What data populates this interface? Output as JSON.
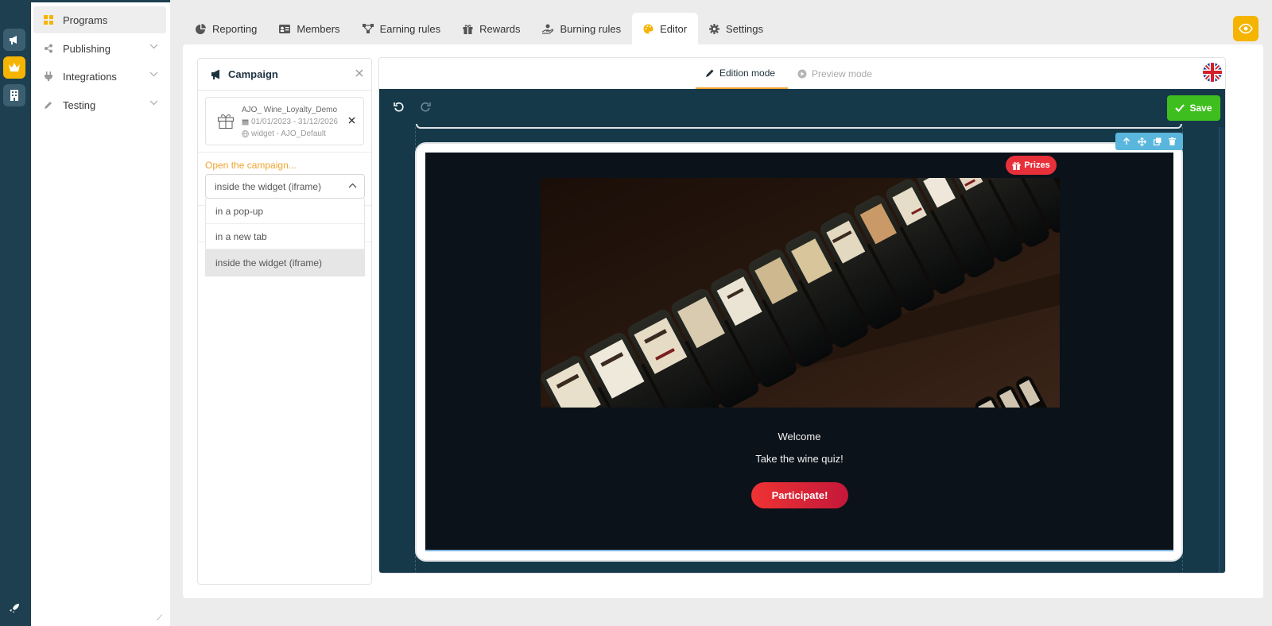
{
  "sidebar": {
    "items": [
      {
        "label": "Programs",
        "icon": "grid-icon",
        "active": true
      },
      {
        "label": "Publishing",
        "icon": "share-icon"
      },
      {
        "label": "Integrations",
        "icon": "plug-icon"
      },
      {
        "label": "Testing",
        "icon": "pencil-icon"
      }
    ]
  },
  "tabs": [
    {
      "label": "Reporting",
      "icon": "pie-chart-icon"
    },
    {
      "label": "Members",
      "icon": "id-card-icon"
    },
    {
      "label": "Earning rules",
      "icon": "flow-icon"
    },
    {
      "label": "Rewards",
      "icon": "gift-icon"
    },
    {
      "label": "Burning rules",
      "icon": "hand-coin-icon"
    },
    {
      "label": "Editor",
      "icon": "palette-icon",
      "active": true
    },
    {
      "label": "Settings",
      "icon": "gear-icon"
    }
  ],
  "panel": {
    "title": "Campaign",
    "campaign": {
      "name": "AJO_ Wine_Loyalty_Demo",
      "dates": "01/01/2023 - 31/12/2026",
      "widget": "widget - AJO_Default"
    },
    "open_label": "Open the campaign...",
    "select_value": "inside the widget (iframe)",
    "options": [
      "in a pop-up",
      "in a new tab",
      "inside the widget (iframe)"
    ]
  },
  "editor": {
    "edition_mode": "Edition mode",
    "preview_mode": "Preview mode",
    "save_label": "Save",
    "prizes_label": "Prizes",
    "welcome": "Welcome",
    "quiz": "Take the wine quiz!",
    "participate": "Participate!"
  },
  "colors": {
    "accent": "#f5b400",
    "rail": "#1d3f4f",
    "canvas": "#16394a",
    "save": "#3fbf1f",
    "prizes": "#e8303a",
    "link_orange": "#f0a430"
  }
}
